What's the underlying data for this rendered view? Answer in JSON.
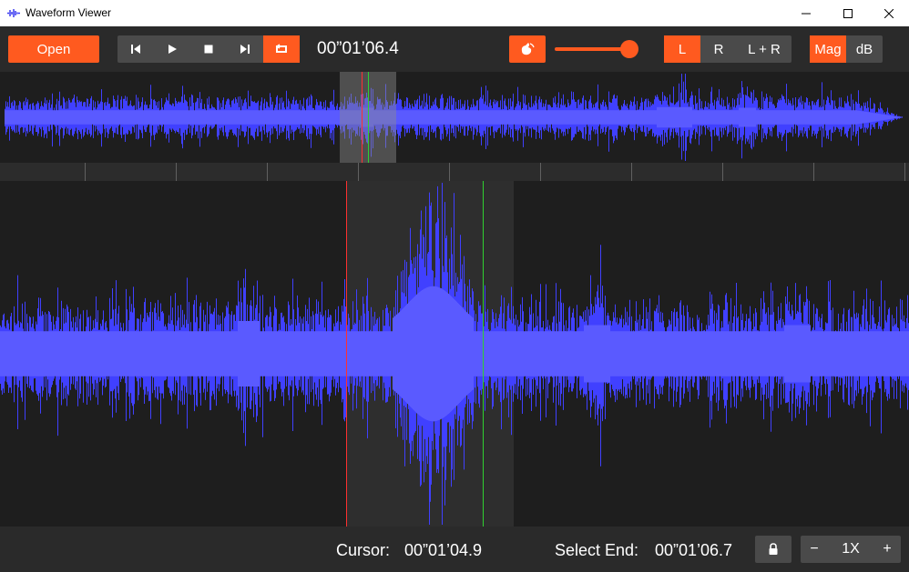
{
  "window": {
    "title": "Waveform Viewer"
  },
  "toolbar": {
    "open_label": "Open",
    "time": "00”01’06.4",
    "volume_level": 0.9,
    "channels": [
      {
        "label": "L",
        "active": true
      },
      {
        "label": "R",
        "active": false
      },
      {
        "label": "L + R",
        "active": false
      }
    ],
    "modes": [
      {
        "label": "Mag",
        "active": true
      },
      {
        "label": "dB",
        "active": false
      }
    ],
    "transport_icons": [
      "skip-back-icon",
      "play-icon",
      "stop-icon",
      "skip-forward-icon",
      "loop-icon"
    ],
    "loop_active": true
  },
  "status": {
    "cursor_label": "Cursor:",
    "cursor_value": "00”01’04.9",
    "select_end_label": "Select End:",
    "select_end_value": "00”01’06.7",
    "zoom_minus": "−",
    "zoom_value": "1X",
    "zoom_plus": "+"
  },
  "colors": {
    "accent": "#ff5a1f",
    "waveform": "#4040ff",
    "cursor_line": "#ff3030",
    "select_end_line": "#30d030",
    "panel": "#2a2a2a",
    "background": "#1e1e1e"
  }
}
